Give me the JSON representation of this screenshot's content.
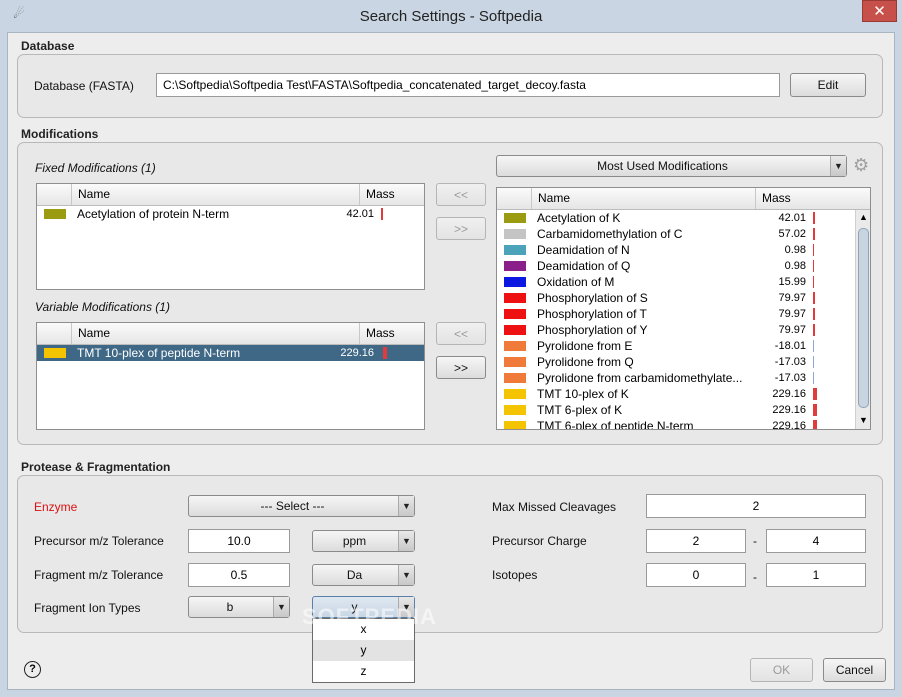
{
  "window": {
    "title": "Search Settings - Softpedia",
    "close_glyph": "✕",
    "app_icon_glyph": "☄"
  },
  "database": {
    "section_title": "Database",
    "label": "Database (FASTA)",
    "path": "C:\\Softpedia\\Softpedia Test\\FASTA\\Softpedia_concatenated_target_decoy.fasta",
    "edit_label": "Edit"
  },
  "modifications": {
    "section_title": "Modifications",
    "fixed_title": "Fixed Modifications (1)",
    "variable_title": "Variable Modifications (1)",
    "col_name": "Name",
    "col_mass": "Mass",
    "fixed_rows": [
      {
        "name": "Acetylation of protein N-term",
        "mass": "42.01",
        "color": "#9b9b12"
      }
    ],
    "variable_rows": [
      {
        "name": "TMT 10-plex of peptide N-term",
        "mass": "229.16",
        "color": "#f5c400",
        "selected": true
      }
    ],
    "add_fixed": "<<",
    "remove_fixed": ">>",
    "add_variable": "<<",
    "remove_variable": ">>",
    "list_selector": "Most Used Modifications",
    "available_rows": [
      {
        "name": "Acetylation of K",
        "mass": "42.01",
        "color": "#9b9b12"
      },
      {
        "name": "Carbamidomethylation of C",
        "mass": "57.02",
        "color": "#c4c4c4"
      },
      {
        "name": "Deamidation of N",
        "mass": "0.98",
        "color": "#4aa3b8"
      },
      {
        "name": "Deamidation of Q",
        "mass": "0.98",
        "color": "#8a1f8a"
      },
      {
        "name": "Oxidation of M",
        "mass": "15.99",
        "color": "#0a18e0"
      },
      {
        "name": "Phosphorylation of S",
        "mass": "79.97",
        "color": "#ee1111"
      },
      {
        "name": "Phosphorylation of T",
        "mass": "79.97",
        "color": "#ee1111"
      },
      {
        "name": "Phosphorylation of Y",
        "mass": "79.97",
        "color": "#ee1111"
      },
      {
        "name": "Pyrolidone from E",
        "mass": "-18.01",
        "color": "#f07a3a"
      },
      {
        "name": "Pyrolidone from Q",
        "mass": "-17.03",
        "color": "#f07a3a"
      },
      {
        "name": "Pyrolidone from carbamidomethylate...",
        "mass": "-17.03",
        "color": "#f07a3a"
      },
      {
        "name": "TMT 10-plex of K",
        "mass": "229.16",
        "color": "#f5c400"
      },
      {
        "name": "TMT 6-plex of K",
        "mass": "229.16",
        "color": "#f5c400"
      },
      {
        "name": "TMT 6-plex of peptide N-term",
        "mass": "229.16",
        "color": "#f5c400"
      }
    ]
  },
  "protease": {
    "section_title": "Protease & Fragmentation",
    "enzyme_label": "Enzyme",
    "enzyme_value": "--- Select ---",
    "precursor_tol_label": "Precursor m/z Tolerance",
    "precursor_tol_value": "10.0",
    "precursor_tol_unit": "ppm",
    "fragment_tol_label": "Fragment m/z Tolerance",
    "fragment_tol_value": "0.5",
    "fragment_tol_unit": "Da",
    "ion_types_label": "Fragment Ion Types",
    "ion_type_1": "b",
    "ion_type_2": "y",
    "ion_type_options": [
      "x",
      "y",
      "z"
    ],
    "max_missed_label": "Max Missed Cleavages",
    "max_missed_value": "2",
    "charge_label": "Precursor Charge",
    "charge_min": "2",
    "charge_max": "4",
    "isotopes_label": "Isotopes",
    "isotopes_min": "0",
    "isotopes_max": "1",
    "dash": "-"
  },
  "footer": {
    "help_glyph": "?",
    "ok_label": "OK",
    "cancel_label": "Cancel"
  },
  "watermark": "SOFTPEDIA"
}
